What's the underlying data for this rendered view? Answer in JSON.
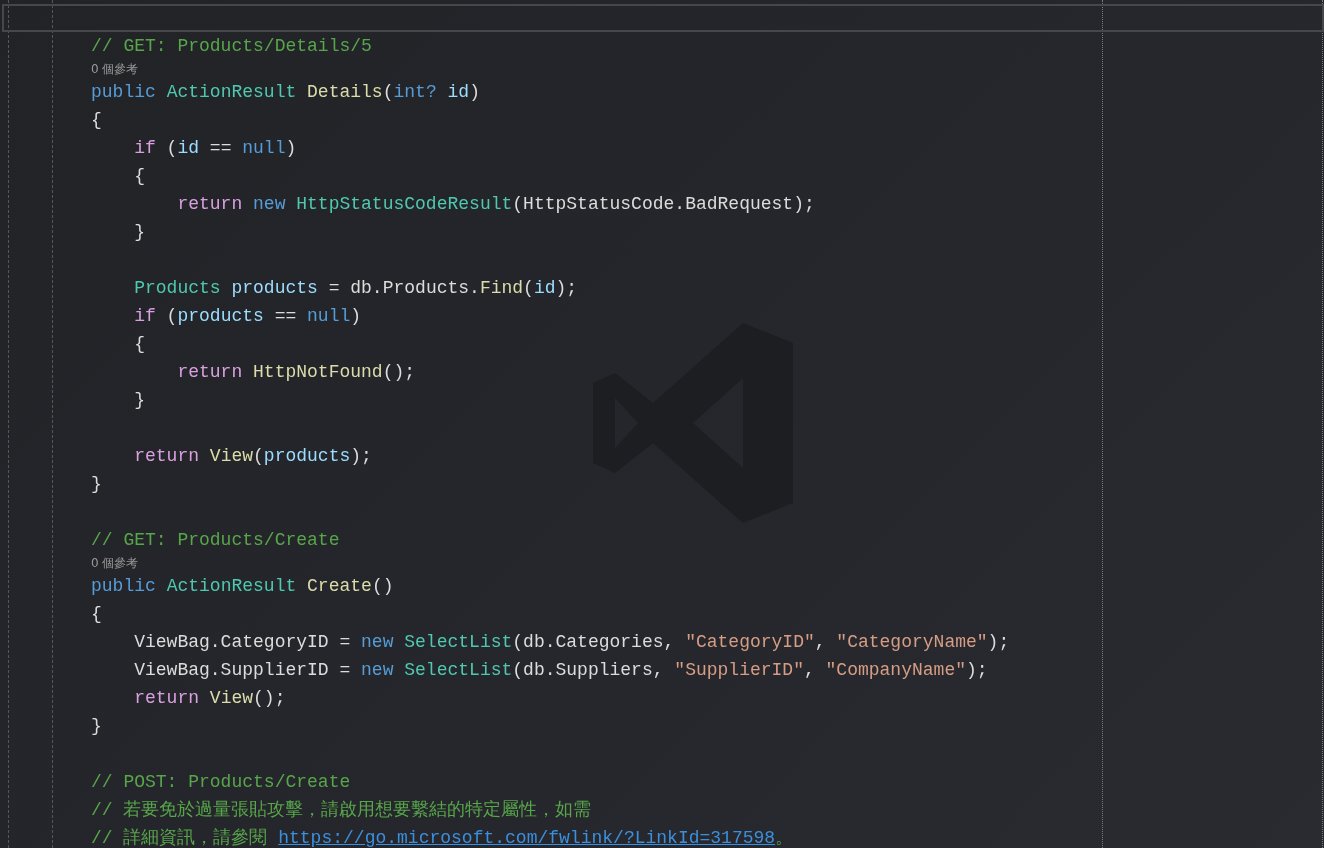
{
  "editor": {
    "lines": [
      {
        "kind": "code",
        "tokens": [
          {
            "text": "// GET: Products/Details/5",
            "kind": "comment"
          }
        ]
      },
      {
        "kind": "codelens",
        "tokens": [
          {
            "text": "0 個參考",
            "kind": "codelens"
          }
        ]
      },
      {
        "kind": "code",
        "tokens": [
          {
            "text": "public ",
            "kind": "keyword"
          },
          {
            "text": "ActionResult ",
            "kind": "type"
          },
          {
            "text": "Details",
            "kind": "method"
          },
          {
            "text": "(",
            "kind": "plain"
          },
          {
            "text": "int? ",
            "kind": "keyword"
          },
          {
            "text": "id",
            "kind": "variable"
          },
          {
            "text": ")",
            "kind": "plain"
          }
        ]
      },
      {
        "kind": "code",
        "tokens": [
          {
            "text": "{",
            "kind": "plain"
          }
        ]
      },
      {
        "kind": "code",
        "tokens": [
          {
            "text": "    if",
            "kind": "control"
          },
          {
            "text": " (",
            "kind": "plain"
          },
          {
            "text": "id",
            "kind": "variable"
          },
          {
            "text": " == ",
            "kind": "plain"
          },
          {
            "text": "null",
            "kind": "keyword"
          },
          {
            "text": ")",
            "kind": "plain"
          }
        ]
      },
      {
        "kind": "code",
        "tokens": [
          {
            "text": "    {",
            "kind": "plain"
          }
        ]
      },
      {
        "kind": "code",
        "tokens": [
          {
            "text": "        return ",
            "kind": "control"
          },
          {
            "text": "new ",
            "kind": "keyword"
          },
          {
            "text": "HttpStatusCodeResult",
            "kind": "type"
          },
          {
            "text": "(HttpStatusCode.BadRequest);",
            "kind": "plain"
          }
        ]
      },
      {
        "kind": "code",
        "tokens": [
          {
            "text": "    }",
            "kind": "plain"
          }
        ]
      },
      {
        "kind": "blank"
      },
      {
        "kind": "code",
        "tokens": [
          {
            "text": "    Products ",
            "kind": "type"
          },
          {
            "text": "products",
            "kind": "variable"
          },
          {
            "text": " = db.Products.",
            "kind": "plain"
          },
          {
            "text": "Find",
            "kind": "method"
          },
          {
            "text": "(",
            "kind": "plain"
          },
          {
            "text": "id",
            "kind": "variable"
          },
          {
            "text": ");",
            "kind": "plain"
          }
        ]
      },
      {
        "kind": "code",
        "tokens": [
          {
            "text": "    if",
            "kind": "control"
          },
          {
            "text": " (",
            "kind": "plain"
          },
          {
            "text": "products",
            "kind": "variable"
          },
          {
            "text": " == ",
            "kind": "plain"
          },
          {
            "text": "null",
            "kind": "keyword"
          },
          {
            "text": ")",
            "kind": "plain"
          }
        ]
      },
      {
        "kind": "code",
        "tokens": [
          {
            "text": "    {",
            "kind": "plain"
          }
        ]
      },
      {
        "kind": "code",
        "tokens": [
          {
            "text": "        return ",
            "kind": "control"
          },
          {
            "text": "HttpNotFound",
            "kind": "method"
          },
          {
            "text": "();",
            "kind": "plain"
          }
        ]
      },
      {
        "kind": "code",
        "tokens": [
          {
            "text": "    }",
            "kind": "plain"
          }
        ]
      },
      {
        "kind": "blank"
      },
      {
        "kind": "code",
        "tokens": [
          {
            "text": "    return ",
            "kind": "control"
          },
          {
            "text": "View",
            "kind": "method"
          },
          {
            "text": "(",
            "kind": "plain"
          },
          {
            "text": "products",
            "kind": "variable"
          },
          {
            "text": ");",
            "kind": "plain"
          }
        ]
      },
      {
        "kind": "code",
        "tokens": [
          {
            "text": "}",
            "kind": "plain"
          }
        ]
      },
      {
        "kind": "blank"
      },
      {
        "kind": "code",
        "tokens": [
          {
            "text": "// GET: Products/Create",
            "kind": "comment"
          }
        ]
      },
      {
        "kind": "codelens",
        "tokens": [
          {
            "text": "0 個參考",
            "kind": "codelens"
          }
        ]
      },
      {
        "kind": "code",
        "tokens": [
          {
            "text": "public ",
            "kind": "keyword"
          },
          {
            "text": "ActionResult ",
            "kind": "type"
          },
          {
            "text": "Create",
            "kind": "method"
          },
          {
            "text": "()",
            "kind": "plain"
          }
        ]
      },
      {
        "kind": "code",
        "tokens": [
          {
            "text": "{",
            "kind": "plain"
          }
        ]
      },
      {
        "kind": "code",
        "tokens": [
          {
            "text": "    ViewBag.CategoryID = ",
            "kind": "plain"
          },
          {
            "text": "new ",
            "kind": "keyword"
          },
          {
            "text": "SelectList",
            "kind": "type"
          },
          {
            "text": "(db.Categories, ",
            "kind": "plain"
          },
          {
            "text": "\"CategoryID\"",
            "kind": "string"
          },
          {
            "text": ", ",
            "kind": "plain"
          },
          {
            "text": "\"CategoryName\"",
            "kind": "string"
          },
          {
            "text": ");",
            "kind": "plain"
          }
        ]
      },
      {
        "kind": "code",
        "tokens": [
          {
            "text": "    ViewBag.SupplierID = ",
            "kind": "plain"
          },
          {
            "text": "new ",
            "kind": "keyword"
          },
          {
            "text": "SelectList",
            "kind": "type"
          },
          {
            "text": "(db.Suppliers, ",
            "kind": "plain"
          },
          {
            "text": "\"SupplierID\"",
            "kind": "string"
          },
          {
            "text": ", ",
            "kind": "plain"
          },
          {
            "text": "\"CompanyName\"",
            "kind": "string"
          },
          {
            "text": ");",
            "kind": "plain"
          }
        ]
      },
      {
        "kind": "code",
        "tokens": [
          {
            "text": "    return ",
            "kind": "control"
          },
          {
            "text": "View",
            "kind": "method"
          },
          {
            "text": "();",
            "kind": "plain"
          }
        ]
      },
      {
        "kind": "code",
        "tokens": [
          {
            "text": "}",
            "kind": "plain"
          }
        ]
      },
      {
        "kind": "blank"
      },
      {
        "kind": "code",
        "tokens": [
          {
            "text": "// POST: Products/Create",
            "kind": "comment"
          }
        ]
      },
      {
        "kind": "code",
        "tokens": [
          {
            "text": "// 若要免於過量張貼攻擊，請啟用想要繫結的特定屬性，如需",
            "kind": "comment"
          }
        ]
      },
      {
        "kind": "code",
        "tokens": [
          {
            "text": "// 詳細資訊，請參閱 ",
            "kind": "comment"
          },
          {
            "text": "https://go.microsoft.com/fwlink/?LinkId=317598",
            "kind": "link"
          },
          {
            "text": "。",
            "kind": "comment"
          }
        ]
      }
    ]
  }
}
